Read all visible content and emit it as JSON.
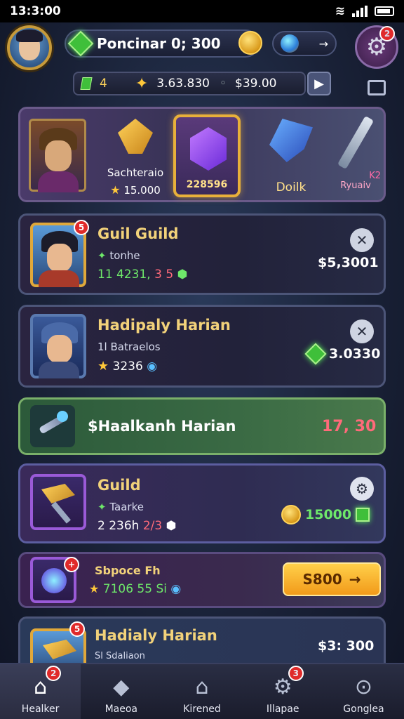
{
  "status_bar": {
    "time": "13:3:00"
  },
  "header": {
    "player_name": "Poncinar 0; 300",
    "settings_badge": "2",
    "resources": {
      "gems": "4",
      "stars": "3.63.830",
      "gold": "$39.00"
    }
  },
  "featured": {
    "items": [
      {
        "name": "Sachteraio",
        "value": "15.000"
      },
      {
        "name": "",
        "value": "228596"
      },
      {
        "name": "Doilk",
        "value": ""
      },
      {
        "name": "",
        "value": "Ryuaiv"
      }
    ],
    "sword_badge": "K2"
  },
  "cards": [
    {
      "title": "Guil Guild",
      "subtitle": "tonhe",
      "stats_left": "4231,",
      "stats_mid": "3 5",
      "price": "$5,3001",
      "badge": "5"
    },
    {
      "title": "Hadipaly Harian",
      "subtitle": "Batraelos",
      "stats_left": "3236",
      "price": "3.0330",
      "prefix": "1l"
    },
    {
      "title": "$Haalkanh Harian",
      "value": "17, 30"
    },
    {
      "title": "Guild",
      "subtitle": "Taarke",
      "stats_left": "2 236h",
      "stats_mid": "2/3",
      "gold_value": "15000"
    },
    {
      "title": "Sbpoce Fh",
      "stats": "7106 55 Si",
      "button_label": "S800"
    },
    {
      "title": "Hadialy Harian",
      "subtitle": "Sl Sdaliaon",
      "price": "$3: 300",
      "badge": "5"
    }
  ],
  "bottom_nav": [
    {
      "label": "Healker",
      "icon": "home-icon",
      "badge": "2"
    },
    {
      "label": "Maeoa",
      "icon": "cube-icon"
    },
    {
      "label": "Kirened",
      "icon": "house-icon"
    },
    {
      "label": "Illapae",
      "icon": "gear-icon",
      "badge": "3"
    },
    {
      "label": "Gonglea",
      "icon": "magnifier-icon"
    }
  ],
  "colors": {
    "accent_gold": "#e0a83a",
    "gem_green": "#3fbf3a",
    "price_red": "#ff6a7a"
  }
}
